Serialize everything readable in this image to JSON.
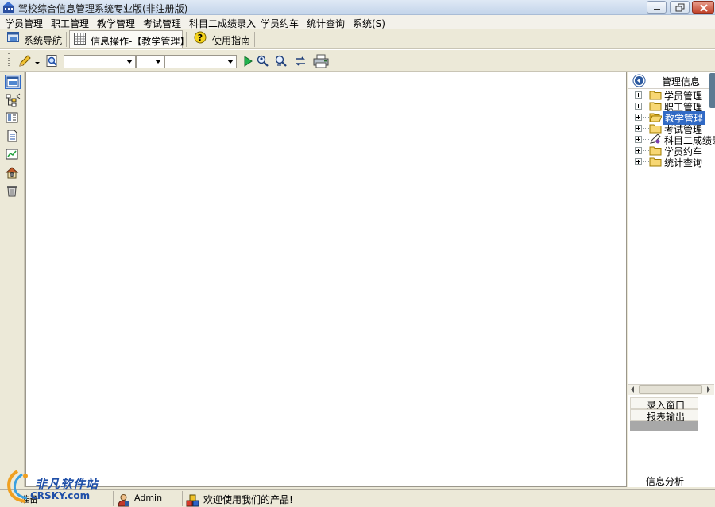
{
  "window": {
    "title": "驾校综合信息管理系统专业版(非注册版)",
    "icon": "app-building-icon"
  },
  "menu": {
    "items": [
      {
        "label": "学员管理"
      },
      {
        "label": "职工管理"
      },
      {
        "label": "教学管理"
      },
      {
        "label": "考试管理"
      },
      {
        "label": "科目二成绩录入"
      },
      {
        "label": "学员约车"
      },
      {
        "label": "统计查询"
      },
      {
        "label": "系统(S)"
      }
    ]
  },
  "tabs": [
    {
      "label": "系统导航",
      "icon": "navigation-window-icon",
      "active": false
    },
    {
      "label": "信息操作-【教学管理】",
      "icon": "grid-table-icon",
      "active": true
    },
    {
      "label": "使用指南",
      "icon": "help-question-icon",
      "active": false
    }
  ],
  "toolbar": {
    "combo1_value": "",
    "combo2_value": "",
    "combo3_value": ""
  },
  "right_panel": {
    "title": "管理信息",
    "tree": [
      {
        "label": "学员管理",
        "selected": false
      },
      {
        "label": "职工管理",
        "selected": false
      },
      {
        "label": "教学管理",
        "selected": true
      },
      {
        "label": "考试管理",
        "selected": false
      },
      {
        "label": "科目二成绩录",
        "selected": false
      },
      {
        "label": "学员约车",
        "selected": false
      },
      {
        "label": "统计查询",
        "selected": false
      }
    ],
    "buttons": {
      "entry_window": "录入窗口",
      "report_output": "报表输出",
      "info_analysis": "信息分析"
    }
  },
  "statusbar": {
    "state": "准备",
    "user": "Admin",
    "message": "欢迎使用我们的产品!"
  },
  "watermark": {
    "cn": "非凡软件站",
    "en": "CRSKY.com"
  },
  "colors": {
    "selection": "#316ac5",
    "close_button": "#c2432a",
    "watermark": "#1f4fa8"
  }
}
